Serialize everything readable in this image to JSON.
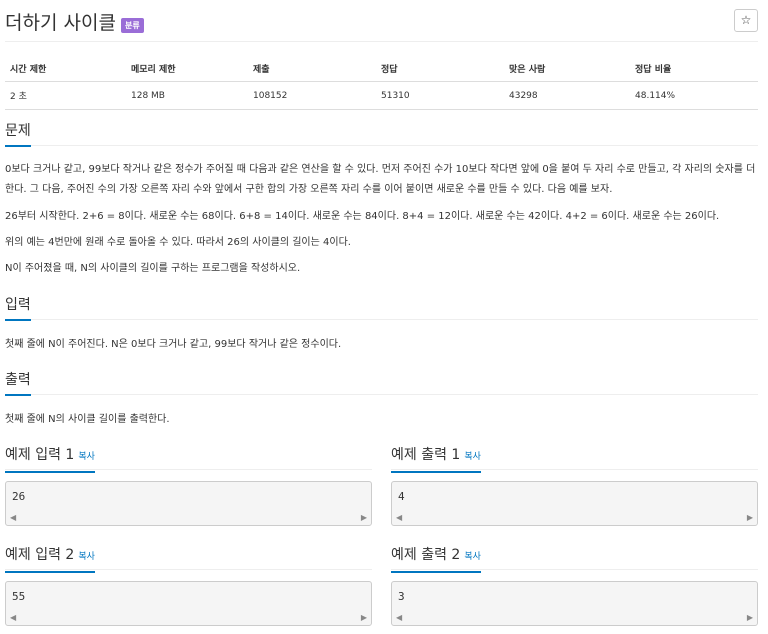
{
  "header": {
    "title": "더하기 사이클",
    "badge": "분류",
    "star": "☆"
  },
  "info_table": {
    "headers": [
      "시간 제한",
      "메모리 제한",
      "제출",
      "정답",
      "맞은 사람",
      "정답 비율"
    ],
    "values": [
      "2 초",
      "128 MB",
      "108152",
      "51310",
      "43298",
      "48.114%"
    ]
  },
  "problem": {
    "title": "문제",
    "p1": "0보다 크거나 같고, 99보다 작거나 같은 정수가 주어질 때 다음과 같은 연산을 할 수 있다. 먼저 주어진 수가 10보다 작다면 앞에 0을 붙여 두 자리 수로 만들고, 각 자리의 숫자를 더한다. 그 다음, 주어진 수의 가장 오른쪽 자리 수와 앞에서 구한 합의 가장 오른쪽 자리 수를 이어 붙이면 새로운 수를 만들 수 있다. 다음 예를 보자.",
    "p2": "26부터 시작한다. 2+6 = 8이다. 새로운 수는 68이다. 6+8 = 14이다. 새로운 수는 84이다. 8+4 = 12이다. 새로운 수는 42이다. 4+2 = 6이다. 새로운 수는 26이다.",
    "p3": "위의 예는 4번만에 원래 수로 돌아올 수 있다. 따라서 26의 사이클의 길이는 4이다.",
    "p4": "N이 주어졌을 때, N의 사이클의 길이를 구하는 프로그램을 작성하시오."
  },
  "input": {
    "title": "입력",
    "text": "첫째 줄에 N이 주어진다. N은 0보다 크거나 같고, 99보다 작거나 같은 정수이다."
  },
  "output": {
    "title": "출력",
    "text": "첫째 줄에 N의 사이클 길이를 출력한다."
  },
  "samples": [
    {
      "title": "예제 입력 1",
      "copy": "복사",
      "value": "26"
    },
    {
      "title": "예제 출력 1",
      "copy": "복사",
      "value": "4"
    },
    {
      "title": "예제 입력 2",
      "copy": "복사",
      "value": "55"
    },
    {
      "title": "예제 출력 2",
      "copy": "복사",
      "value": "3"
    }
  ],
  "scroll": {
    "left": "◀",
    "right": "▶"
  },
  "colors": {
    "accent": "#0076c0",
    "badge": "#9a6dd7"
  }
}
